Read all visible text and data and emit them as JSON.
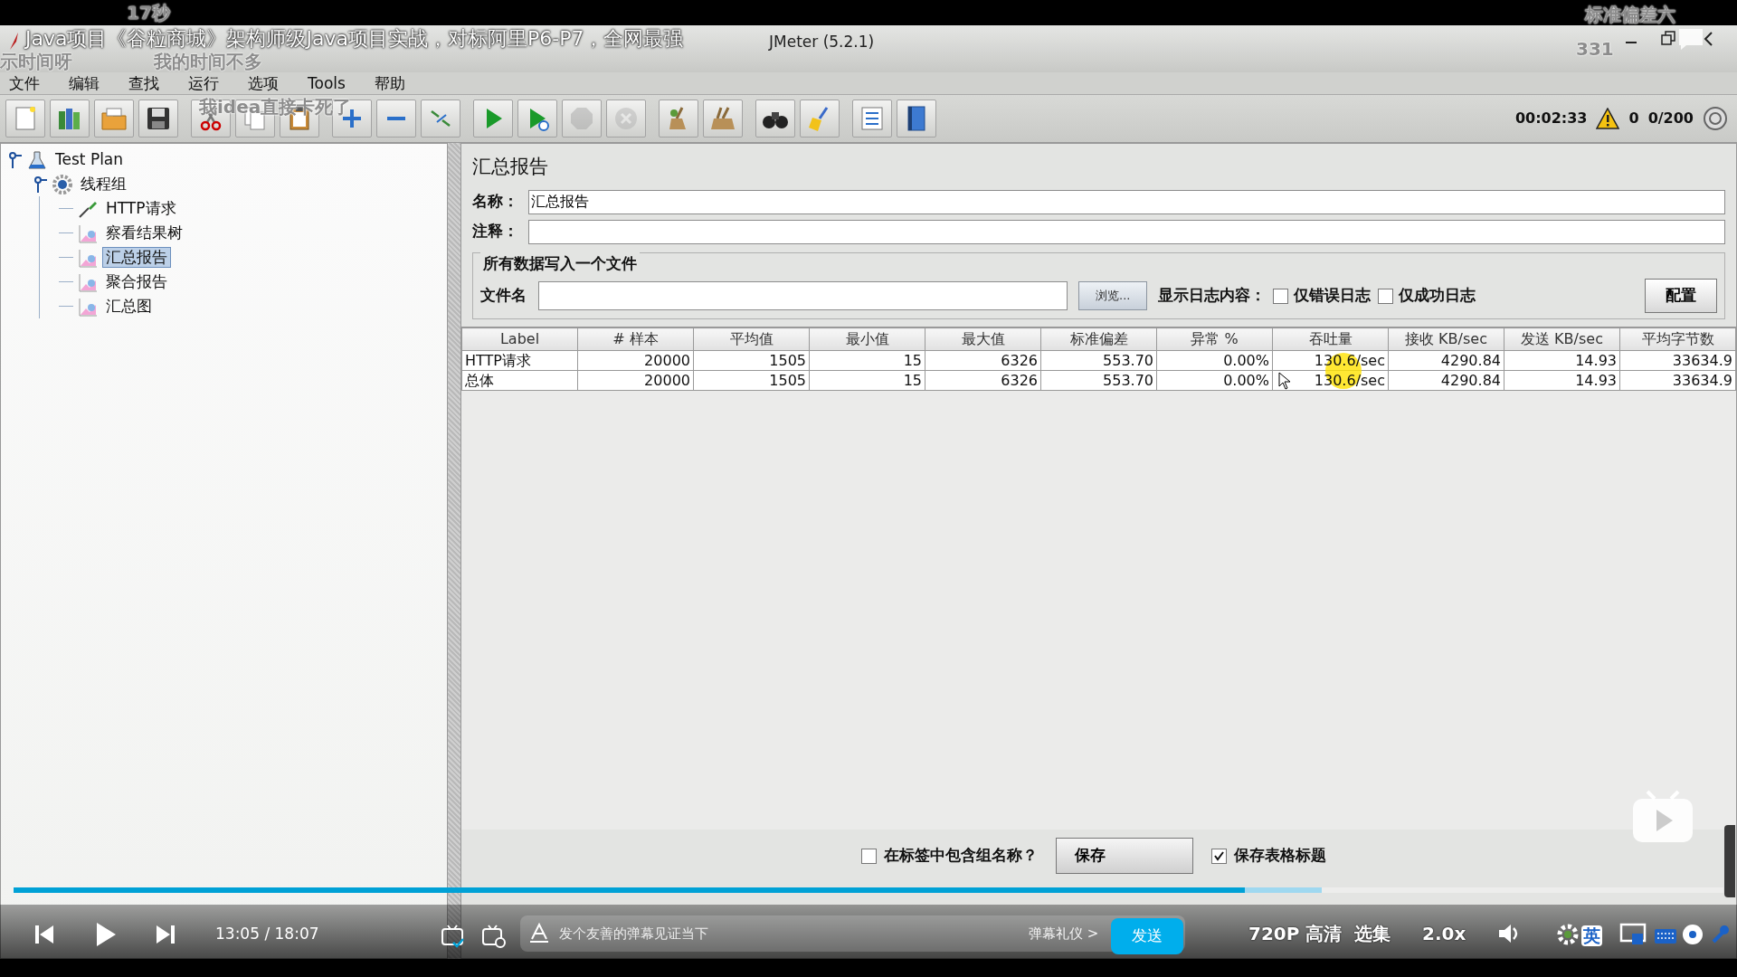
{
  "video": {
    "title": "Java项目《谷粒商城》架构师级Java项目实战，对标阿里P6-P7，全网最强",
    "danmaku": [
      "17秒",
      "示时间呀",
      "我的时间不多",
      "我idea直接卡死了",
      "标准偏差六",
      "331"
    ],
    "progress": {
      "level": 0.72
    },
    "buffer": {
      "level": 0.765
    },
    "time": "13:05 / 18:07",
    "danmaku_placeholder": "发个友善的弹幕见证当下",
    "etiquette": "弹幕礼仪 >",
    "send": "发送",
    "quality": "720P 高清",
    "episodes": "选集",
    "speed": "2.0x",
    "ime": "英"
  },
  "window": {
    "title": "JMeter (5.2.1)"
  },
  "menu": [
    "文件",
    "编辑",
    "查找",
    "运行",
    "选项",
    "Tools",
    "帮助"
  ],
  "toolbar": [
    {
      "buttons": [
        {
          "kind": "new",
          "disabled": false
        },
        {
          "kind": "templates",
          "disabled": false
        },
        {
          "kind": "open",
          "disabled": false
        },
        {
          "kind": "save",
          "disabled": false
        }
      ]
    },
    {
      "buttons": [
        {
          "kind": "cut",
          "disabled": false
        },
        {
          "kind": "copy",
          "disabled": false
        },
        {
          "kind": "paste",
          "disabled": false
        }
      ]
    },
    {
      "buttons": [
        {
          "kind": "expand",
          "disabled": false
        },
        {
          "kind": "collapse",
          "disabled": false
        },
        {
          "kind": "toggle",
          "disabled": false
        }
      ]
    },
    {
      "buttons": [
        {
          "kind": "start",
          "disabled": false
        },
        {
          "kind": "start-no-pause",
          "disabled": false
        },
        {
          "kind": "stop",
          "disabled": true
        },
        {
          "kind": "shutdown",
          "disabled": true
        }
      ]
    },
    {
      "buttons": [
        {
          "kind": "clear",
          "disabled": false
        },
        {
          "kind": "clear-all",
          "disabled": false
        }
      ]
    },
    {
      "buttons": [
        {
          "kind": "search",
          "disabled": false
        },
        {
          "kind": "reset",
          "disabled": false
        }
      ]
    },
    {
      "buttons": [
        {
          "kind": "function",
          "disabled": false
        },
        {
          "kind": "help",
          "disabled": false
        }
      ]
    }
  ],
  "status": {
    "timer": "00:02:33",
    "errors": "0",
    "threads": "0/200"
  },
  "tree": [
    {
      "label": "Test Plan",
      "kind": "plan",
      "selected": false,
      "expanded": true,
      "children": [
        {
          "label": "线程组",
          "kind": "threads",
          "selected": false,
          "expanded": true,
          "children": [
            {
              "label": "HTTP请求",
              "kind": "sampler",
              "selected": false
            },
            {
              "label": "察看结果树",
              "kind": "listener",
              "selected": false
            },
            {
              "label": "汇总报告",
              "kind": "listener",
              "selected": true
            },
            {
              "label": "聚合报告",
              "kind": "listener",
              "selected": false
            },
            {
              "label": "汇总图",
              "kind": "listener",
              "selected": false
            }
          ]
        }
      ]
    }
  ],
  "panel": {
    "title": "汇总报告",
    "name_label": "名称：",
    "name_value": "汇总报告",
    "comment_label": "注释：",
    "file_group": "所有数据写入一个文件",
    "filename_label": "文件名",
    "browse": "浏览...",
    "log_label": "显示日志内容：",
    "log_options": [
      {
        "label": "仅错误日志",
        "checked": false
      },
      {
        "label": "仅成功日志",
        "checked": false
      }
    ],
    "configure": "配置"
  },
  "table": {
    "columns": [
      "Label",
      "# 样本",
      "平均值",
      "最小值",
      "最大值",
      "标准偏差",
      "异常 %",
      "吞吐量",
      "接收 KB/sec",
      "发送 KB/sec",
      "平均字节数"
    ],
    "rows": [
      [
        "HTTP请求",
        "20000",
        "1505",
        "15",
        "6326",
        "553.70",
        "0.00%",
        "130.6/sec",
        "4290.84",
        "14.93",
        "33634.9"
      ],
      [
        "总体",
        "20000",
        "1505",
        "15",
        "6326",
        "553.70",
        "0.00%",
        "130.6/sec",
        "4290.84",
        "14.93",
        "33634.9"
      ]
    ]
  },
  "bottom_options": [
    {
      "kind": "checkbox",
      "label": "在标签中包含组名称？",
      "checked": false
    },
    {
      "kind": "button",
      "label": "保存"
    },
    {
      "kind": "checkbox",
      "label": "保存表格标题",
      "checked": true
    }
  ]
}
